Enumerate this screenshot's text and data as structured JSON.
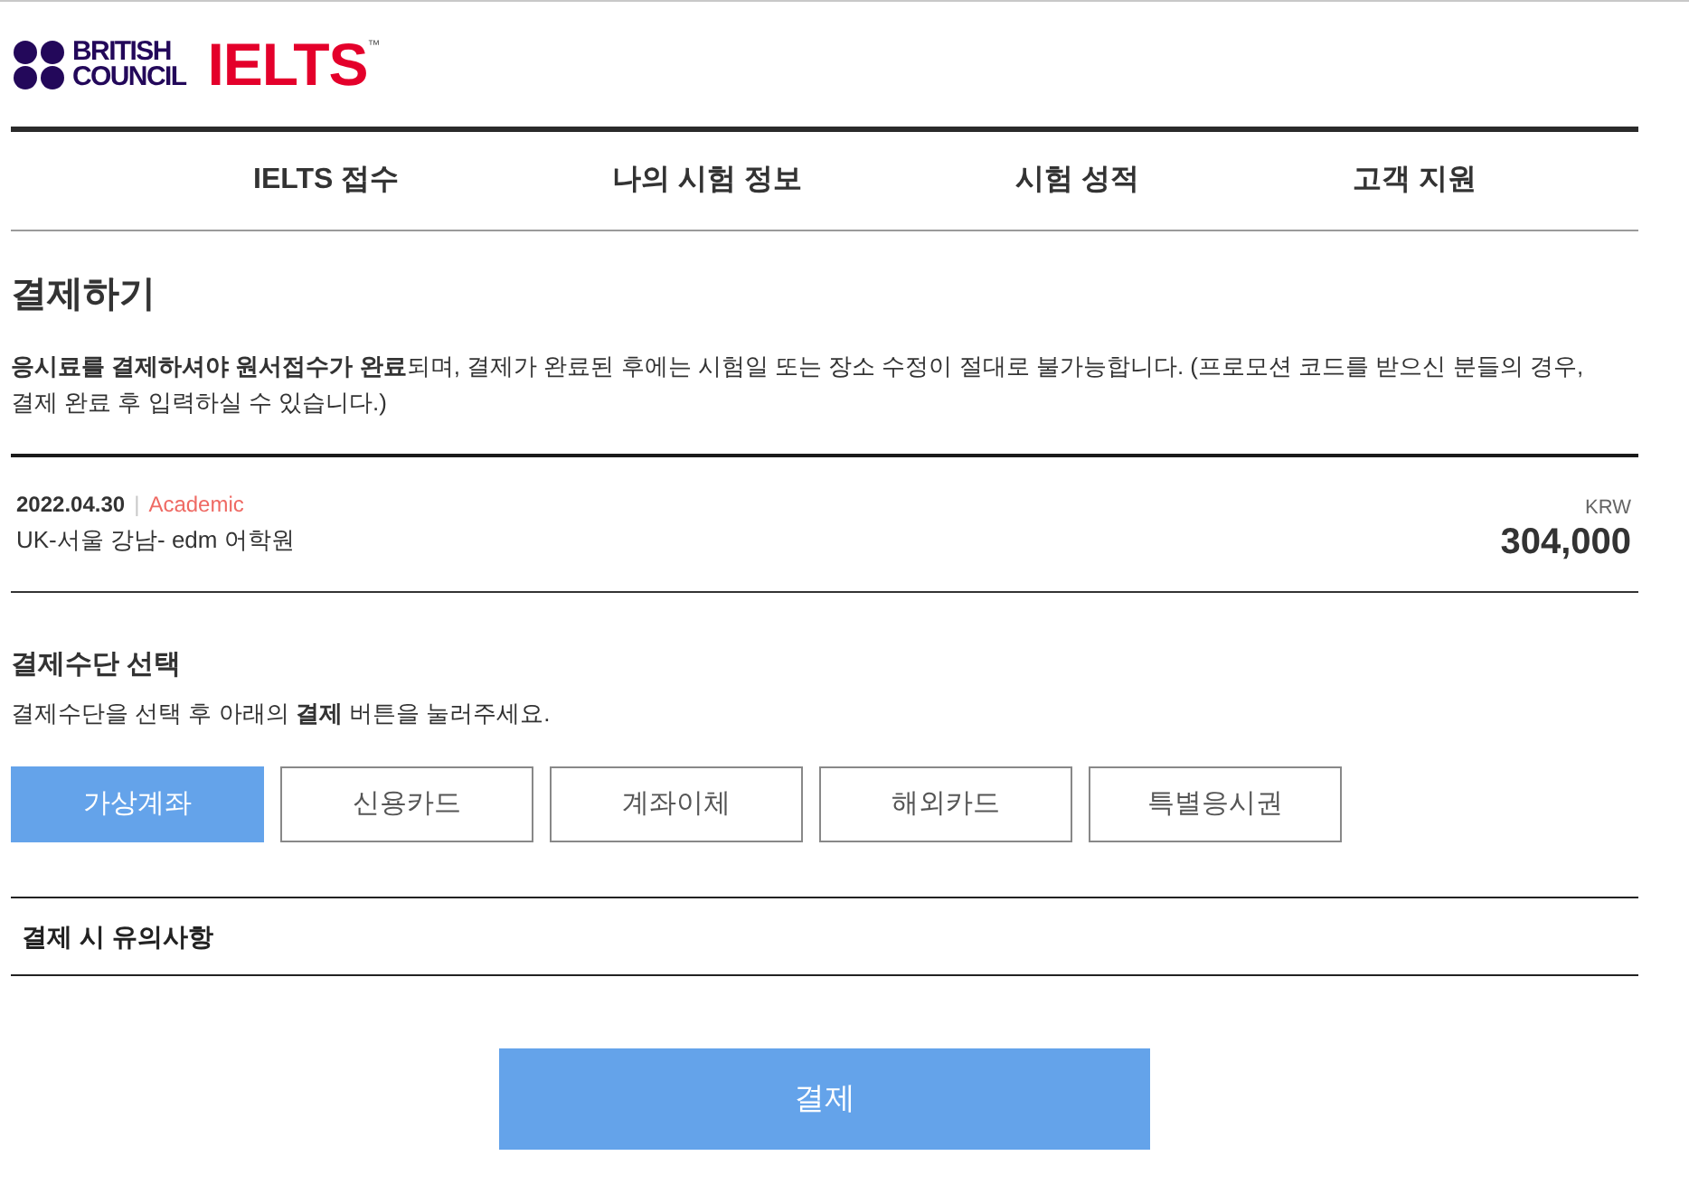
{
  "logo": {
    "brand_lines": [
      "BRITISH",
      "COUNCIL"
    ],
    "product": "IELTS",
    "trademark": "™"
  },
  "nav": [
    {
      "label": "IELTS 접수"
    },
    {
      "label": "나의 시험 정보"
    },
    {
      "label": "시험 성적"
    },
    {
      "label": "고객 지원"
    }
  ],
  "page_title": "결제하기",
  "notice": "**응시료를 결제하셔야 원서접수가 완료**되며, 결제가 완료된 후에는 시험일 또는 장소 수정이 절대로 불가능합니다. (프로모션 코드를 받으신 분들의 경우, 결제 완료 후 입력하실 수 있습니다.)",
  "exam": {
    "date": "2022.04.30",
    "separator": "|",
    "module": "Academic",
    "venue": "UK-서울 강남- edm 어학원",
    "currency": "KRW",
    "amount": "304,000"
  },
  "payment_methods": {
    "title": "결제수단 선택",
    "hint": "결제수단을 선택 후 아래의 **결제** 버튼을 눌러주세요.",
    "options": [
      {
        "label": "가상계좌",
        "selected": true
      },
      {
        "label": "신용카드",
        "selected": false
      },
      {
        "label": "계좌이체",
        "selected": false
      },
      {
        "label": "해외카드",
        "selected": false
      },
      {
        "label": "특별응시권",
        "selected": false
      }
    ]
  },
  "caution": {
    "title": "결제 시 유의사항"
  },
  "pay_button": "결제"
}
